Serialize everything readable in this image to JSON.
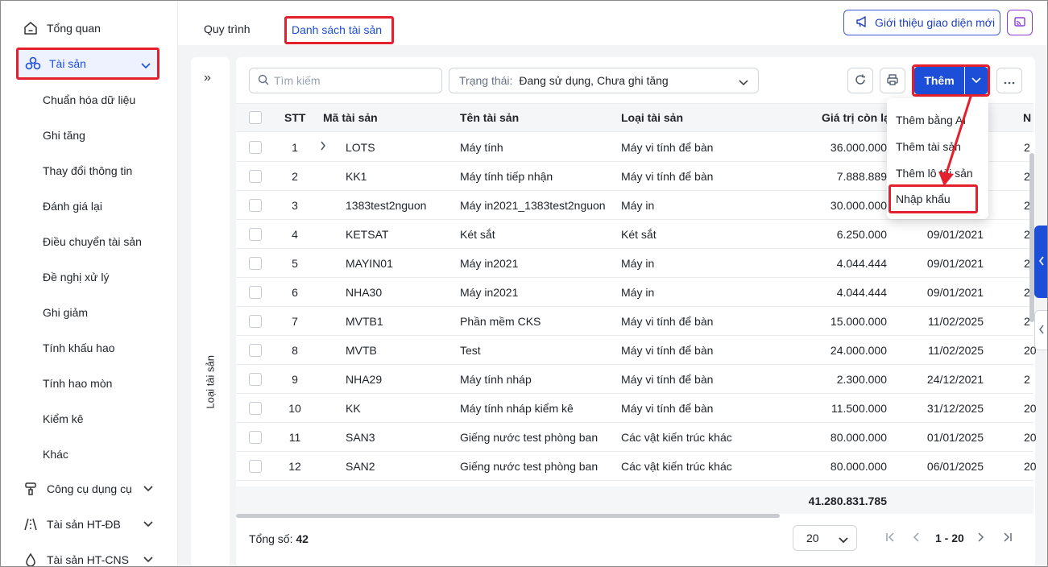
{
  "sidebar": {
    "items": [
      {
        "label": "Tổng quan",
        "icon": "home-icon"
      },
      {
        "label": "Tài sản",
        "icon": "assets-icon",
        "active": true
      },
      {
        "label": "Công cụ dụng cụ",
        "icon": "tools-icon"
      },
      {
        "label": "Tài sản HT-ĐB",
        "icon": "road-icon"
      },
      {
        "label": "Tài sản HT-CNS",
        "icon": "water-icon"
      }
    ],
    "subitems": [
      "Chuẩn hóa dữ liệu",
      "Ghi tăng",
      "Thay đổi thông tin",
      "Đánh giá lại",
      "Điều chuyển tài sản",
      "Đề nghị xử lý",
      "Ghi giảm",
      "Tính khấu hao",
      "Tính hao mòn",
      "Kiểm kê",
      "Khác"
    ]
  },
  "tabs": {
    "process": "Quy trình",
    "asset_list": "Danh sách tài sản"
  },
  "header": {
    "intro_button": "Giới thiệu giao diện mới"
  },
  "rail": {
    "label": "Loại tài sản"
  },
  "toolbar": {
    "search_placeholder": "Tìm kiếm",
    "status_label": "Trạng thái:",
    "status_value": "Đang sử dụng, Chưa ghi tăng",
    "add_label": "Thêm"
  },
  "add_menu": {
    "items": [
      "Thêm bằng AI",
      "Thêm tài sản",
      "Thêm lô tài sản",
      "Nhập khẩu"
    ],
    "highlighted": "Nhập khẩu"
  },
  "table": {
    "headers": {
      "stt": "STT",
      "code": "Mã tài sản",
      "name": "Tên tài sản",
      "type": "Loại tài sản",
      "value": "Giá trị còn lại",
      "extra": "N"
    },
    "rows": [
      {
        "stt": "1",
        "code": "LOTS",
        "name": "Máy tính",
        "type": "Máy vi tính để bàn",
        "value": "36.000.000",
        "date": "",
        "extra": "2",
        "expand": true
      },
      {
        "stt": "2",
        "code": "KK1",
        "name": "Máy tính tiếp nhận",
        "type": "Máy vi tính để bàn",
        "value": "7.888.889",
        "date": "",
        "extra": "2"
      },
      {
        "stt": "3",
        "code": "1383test2nguon",
        "name": "Máy in2021_1383test2nguon",
        "type": "Máy in",
        "value": "30.000.000",
        "date": "",
        "extra": "2"
      },
      {
        "stt": "4",
        "code": "KETSAT",
        "name": "Két sắt",
        "type": "Két sắt",
        "value": "6.250.000",
        "date": "09/01/2021",
        "extra": "2"
      },
      {
        "stt": "5",
        "code": "MAYIN01",
        "name": "Máy in2021",
        "type": "Máy in",
        "value": "4.044.444",
        "date": "09/01/2021",
        "extra": "2"
      },
      {
        "stt": "6",
        "code": "NHA30",
        "name": "Máy in2021",
        "type": "Máy in",
        "value": "4.044.444",
        "date": "09/01/2021",
        "extra": "2"
      },
      {
        "stt": "7",
        "code": "MVTB1",
        "name": "Phần mềm CKS",
        "type": "Máy vi tính để bàn",
        "value": "15.000.000",
        "date": "11/02/2025",
        "extra": "2"
      },
      {
        "stt": "8",
        "code": "MVTB",
        "name": "Test",
        "type": "Máy vi tính để bàn",
        "value": "24.000.000",
        "date": "11/02/2025",
        "extra": "20"
      },
      {
        "stt": "9",
        "code": "NHA29",
        "name": "Máy tính nháp",
        "type": "Máy vi tính để bàn",
        "value": "2.300.000",
        "date": "24/12/2021",
        "extra": "2"
      },
      {
        "stt": "10",
        "code": "KK",
        "name": "Máy tính nháp kiểm kê",
        "type": "Máy vi tính để bàn",
        "value": "11.500.000",
        "date": "31/12/2025",
        "extra": "20"
      },
      {
        "stt": "11",
        "code": "SAN3",
        "name": "Giếng nước test phòng ban",
        "type": "Các vật kiến trúc khác",
        "value": "80.000.000",
        "date": "01/01/2025",
        "extra": "20"
      },
      {
        "stt": "12",
        "code": "SAN2",
        "name": "Giếng nước test phòng ban",
        "type": "Các vật kiến trúc khác",
        "value": "80.000.000",
        "date": "06/01/2025",
        "extra": "20"
      }
    ],
    "total_value": "41.280.831.785"
  },
  "footer": {
    "total_label": "Tổng số:",
    "total_count": "42",
    "page_size": "20",
    "page_range": "1 - 20"
  },
  "colors": {
    "accent": "#1d4ed8",
    "highlight": "#e5202e"
  }
}
